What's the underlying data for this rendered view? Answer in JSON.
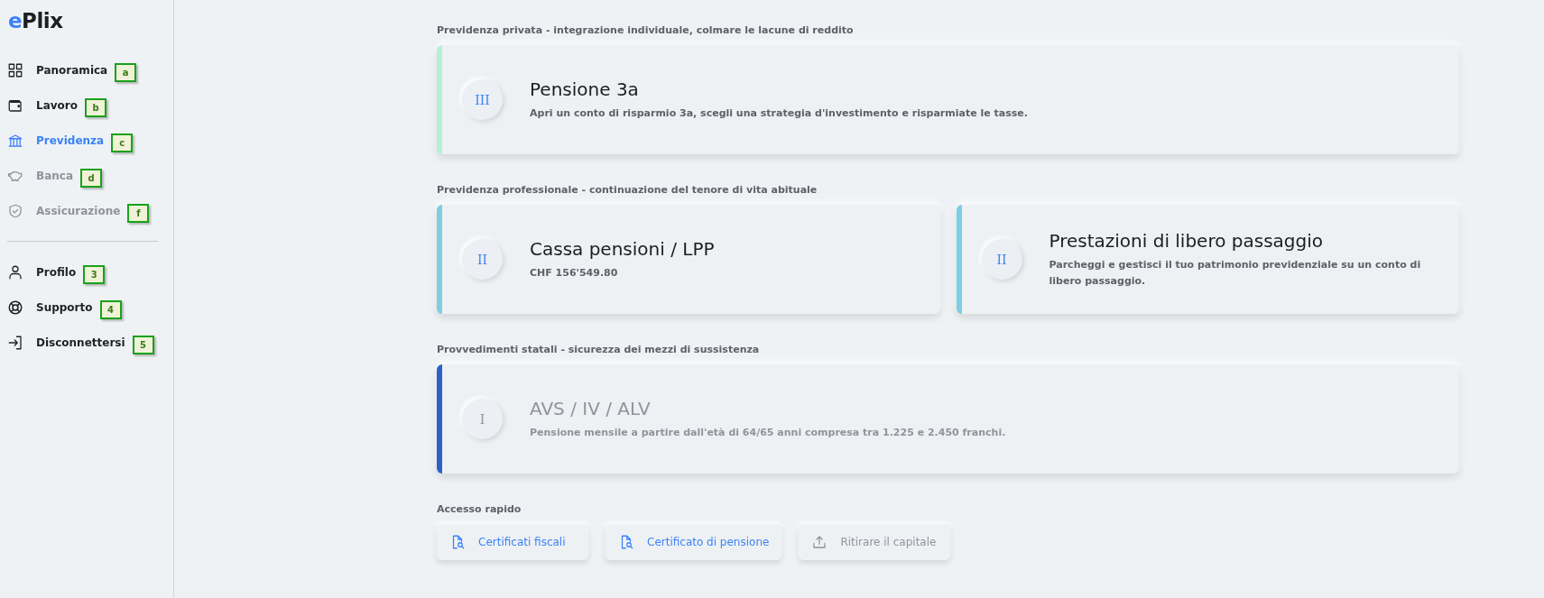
{
  "logo": "ePlix",
  "sidebar": {
    "items": [
      {
        "label": "Panoramica",
        "hint": "a",
        "selected": false,
        "disabled": false
      },
      {
        "label": "Lavoro",
        "hint": "b",
        "selected": false,
        "disabled": false
      },
      {
        "label": "Previdenza",
        "hint": "c",
        "selected": true,
        "disabled": false
      },
      {
        "label": "Banca",
        "hint": "d",
        "selected": false,
        "disabled": true
      },
      {
        "label": "Assicurazione",
        "hint": "f",
        "selected": false,
        "disabled": true
      }
    ],
    "footer_items": [
      {
        "label": "Profilo",
        "hint": "3"
      },
      {
        "label": "Supporto",
        "hint": "4"
      },
      {
        "label": "Disconnettersi",
        "hint": "5"
      }
    ]
  },
  "sections": [
    {
      "title": "Previdenza privata - integrazione individuale, colmare le lacune di reddito",
      "cards": [
        {
          "numeral": "III",
          "title": "Pensione 3a",
          "subtitle": "Apri un conto di risparmio 3a, scegli una strategia d'investimento e risparmiate le tasse.",
          "color": "#b4f0d6",
          "disabled": false
        }
      ]
    },
    {
      "title": "Previdenza professionale - continuazione del tenore di vita abituale",
      "cards": [
        {
          "numeral": "II",
          "title": "Cassa pensioni / LPP",
          "subtitle": "CHF 156'549.80",
          "color": "#7ccfe3",
          "disabled": false
        },
        {
          "numeral": "II",
          "title": "Prestazioni di libero passaggio",
          "subtitle": "Parcheggi e gestisci il tuo patrimonio previdenziale su un conto di libero passaggio.",
          "color": "#7ccfe3",
          "disabled": false
        }
      ]
    },
    {
      "title": "Provvedimenti statali - sicurezza dei mezzi di sussistenza",
      "cards": [
        {
          "numeral": "I",
          "title": "AVS / IV / ALV",
          "subtitle": "Pensione mensile a partire dall'età di 64/65 anni compresa tra 1.225 e 2.450 franchi.",
          "color": "#2b62c8",
          "disabled": true
        }
      ]
    }
  ],
  "quick_access": {
    "title": "Accesso rapido",
    "buttons": [
      {
        "label": "Certificati fiscali",
        "disabled": false
      },
      {
        "label": "Certificato di pensione",
        "disabled": false
      },
      {
        "label": "Ritirare il capitale",
        "disabled": true
      }
    ]
  }
}
